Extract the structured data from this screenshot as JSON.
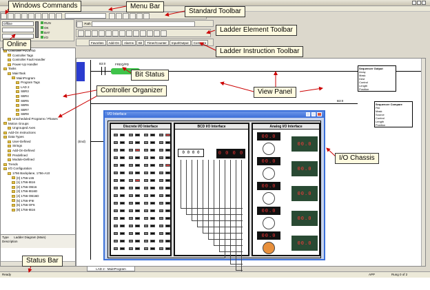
{
  "callouts": {
    "windows_commands": "Windows Commands",
    "menu_bar": "Menu Bar",
    "standard_toolbar": "Standard Toolbar",
    "online": "Online",
    "ladder_element_toolbar": "Ladder Element Toolbar",
    "ladder_instruction_toolbar": "Ladder Instruction Toolbar",
    "bit_status": "Bit Status",
    "controller_organizer": "Controller Organizer",
    "view_panel": "View Panel",
    "io_chassis": "I/O Chassis",
    "status_bar": "Status Bar"
  },
  "online_panel": {
    "mode": "Offline",
    "indicators": [
      "RUN",
      "OK",
      "BAT",
      "I/O"
    ]
  },
  "path_label": "Path",
  "instruction_tabs": [
    "Favorites",
    "Add-On",
    "Alarms",
    "Bit",
    "Timer/Counter",
    "Input/Output",
    "Compare"
  ],
  "organizer_items": [
    "Controller PLC5750",
    "Controller Tags",
    "Controller Fault Handler",
    "Power-Up Handler",
    "Tasks",
    "MainTask",
    "MainProgram",
    "Program Tags",
    "LAD 2",
    "SBR3",
    "SBR4",
    "SBR5",
    "SBR6",
    "SBR7",
    "SBR8",
    "Unscheduled Programs / Phases",
    "Motion Groups",
    "Ungrouped Axes",
    "Add-On Instructions",
    "Data Types",
    "User-Defined",
    "Strings",
    "Add-On-Defined",
    "Predefined",
    "Module-Defined",
    "Trends",
    "I/O Configuration",
    "1756 Backplane, 1756-A10",
    "[0] 1756-L55",
    "[1] 1756-IB16",
    "[2] 1756-OB16",
    "[3] 1756-IB16D",
    "[4] 1756-OB16D",
    "[5] 1756-IF6I",
    "[6] 1756-OF6",
    "[8] 1756-IB16"
  ],
  "organizer_footer": {
    "type_label": "Type",
    "type_value": "Ladder Diagram (Main)",
    "description_label": "Description"
  },
  "ladder": {
    "rung_tag_1": "B3:0",
    "rung_tag_2": "B3:0",
    "out_tag": "FREQ/PD",
    "block1": {
      "title": "Sequencer Output",
      "rows": [
        "Array",
        "Mask",
        "Dest",
        "Control",
        "Length",
        "Position"
      ]
    },
    "block2": {
      "title": "Sequencer Compare",
      "rows": [
        "File",
        "Mask",
        "Source",
        "Control",
        "Length",
        "Position"
      ]
    },
    "end_label": "(End)"
  },
  "io_window": {
    "title": "I/O Interface",
    "discrete_title": "Discrete I/O Interface",
    "bcd_title": "BCD I/O Interface",
    "analog_title": "Analog I/O Interface",
    "bcd_display": "0 0 0 0",
    "analog_display": "00.0"
  },
  "bottom_tab": "LAD 2 - MainProgram",
  "status": {
    "ready": "Ready",
    "app": "APP",
    "rung": "Rung 0 of 2"
  }
}
